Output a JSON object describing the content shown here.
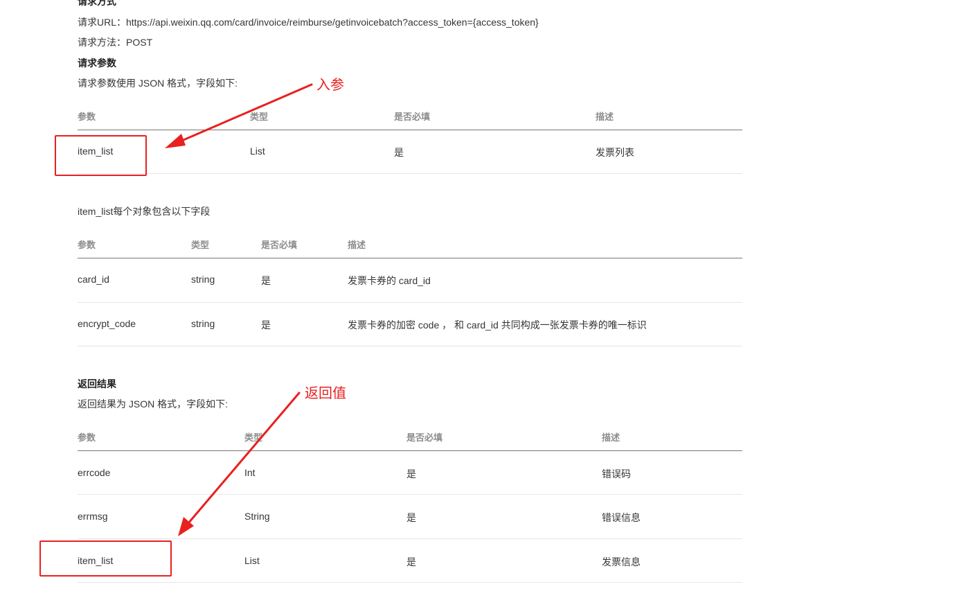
{
  "request": {
    "method_heading": "请求方式",
    "url_line": "请求URL：https://api.weixin.qq.com/card/invoice/reimburse/getinvoicebatch?access_token={access_token}",
    "method_line": "请求方法：POST",
    "params_heading": "请求参数",
    "params_desc": "请求参数使用 JSON 格式，字段如下:"
  },
  "table1": {
    "headers": [
      "参数",
      "类型",
      "是否必填",
      "描述"
    ],
    "rows": [
      [
        "item_list",
        "List",
        "是",
        "发票列表"
      ]
    ]
  },
  "item_list_desc": "item_list每个对象包含以下字段",
  "table2": {
    "headers": [
      "参数",
      "类型",
      "是否必填",
      "描述"
    ],
    "rows": [
      [
        "card_id",
        "string",
        "是",
        "发票卡券的 card_id"
      ],
      [
        "encrypt_code",
        "string",
        "是",
        "发票卡券的加密 code ， 和 card_id 共同构成一张发票卡券的唯一标识"
      ]
    ]
  },
  "response": {
    "heading": "返回结果",
    "desc": "返回结果为 JSON 格式，字段如下:"
  },
  "table3": {
    "headers": [
      "参数",
      "类型",
      "是否必填",
      "描述"
    ],
    "rows": [
      [
        "errcode",
        "Int",
        "是",
        "错误码"
      ],
      [
        "errmsg",
        "String",
        "是",
        "错误信息"
      ],
      [
        "item_list",
        "List",
        "是",
        "发票信息"
      ]
    ]
  },
  "annotations": {
    "input_label": "入参",
    "output_label": "返回值",
    "color": "#e8201f"
  }
}
